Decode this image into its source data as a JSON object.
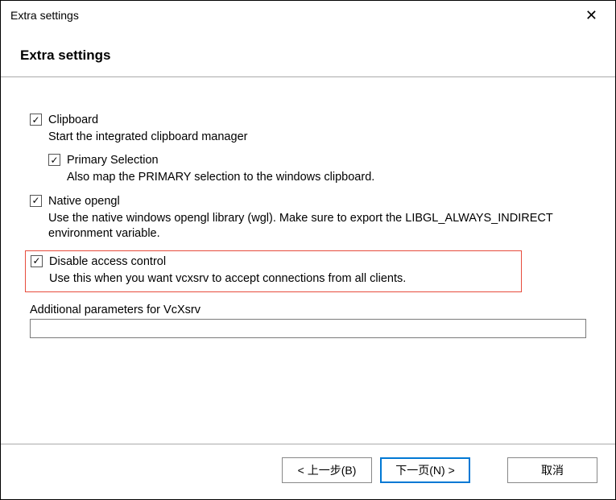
{
  "titlebar": {
    "title": "Extra settings"
  },
  "header": {
    "title": "Extra settings"
  },
  "options": {
    "clipboard": {
      "label": "Clipboard",
      "desc": "Start the integrated clipboard manager",
      "checked": "✓"
    },
    "primary": {
      "label": "Primary Selection",
      "desc": "Also map the PRIMARY selection to the windows clipboard.",
      "checked": "✓"
    },
    "opengl": {
      "label": "Native opengl",
      "desc": "Use the native windows opengl library (wgl). Make sure to export the LIBGL_ALWAYS_INDIRECT environment variable.",
      "checked": "✓"
    },
    "access": {
      "label": "Disable access control",
      "desc": "Use this when you want vcxsrv to accept connections from all clients.",
      "checked": "✓"
    }
  },
  "params": {
    "label": "Additional parameters for VcXsrv",
    "value": ""
  },
  "buttons": {
    "back": "< 上一步(B)",
    "next": "下一页(N) >",
    "cancel": "取消"
  }
}
